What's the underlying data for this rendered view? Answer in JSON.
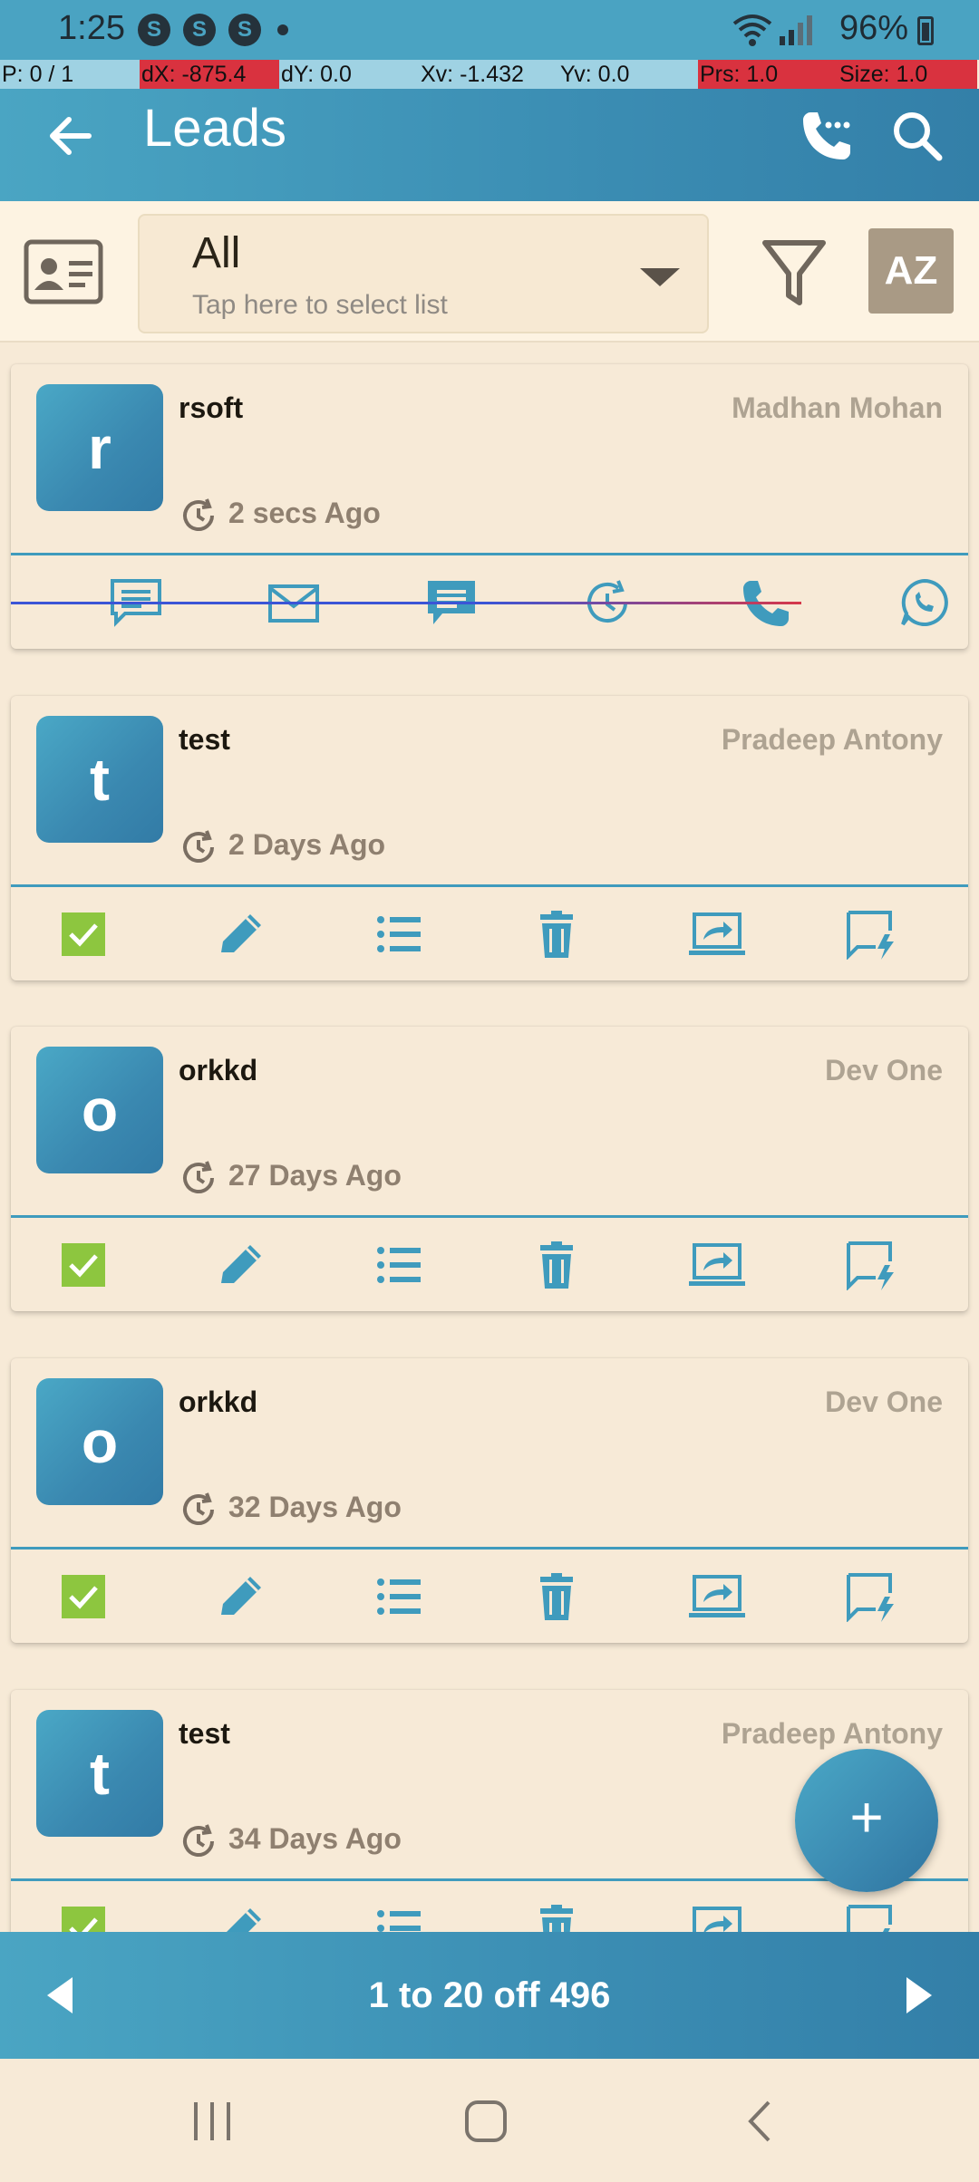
{
  "status_bar": {
    "time": "1:25",
    "notification_icons": [
      "S",
      "S",
      "S"
    ],
    "battery": "96%"
  },
  "debug_overlay": [
    {
      "text": "P: 0 / 1",
      "color": "#9fd2e3"
    },
    {
      "text": "dX: -875.4",
      "color": "#d9323f"
    },
    {
      "text": "dY: 0.0",
      "color": "#9fd2e3"
    },
    {
      "text": "Xv: -1.432",
      "color": "#9fd2e3"
    },
    {
      "text": "Yv: 0.0",
      "color": "#9fd2e3"
    },
    {
      "text": "Prs: 1.0",
      "color": "#d9323f"
    },
    {
      "text": "Size: 1.0",
      "color": "#d9323f"
    }
  ],
  "app_bar": {
    "title": "Leads"
  },
  "filter": {
    "list_value": "All",
    "list_hint": "Tap here to select list",
    "sort_label": "AZ"
  },
  "leads": [
    {
      "initial": "r",
      "name": "rsoft",
      "owner": "Madhan Mohan",
      "ago": "2 secs Ago",
      "swiped": true
    },
    {
      "initial": "t",
      "name": "test",
      "owner": "Pradeep Antony",
      "ago": "2 Days Ago",
      "swiped": false
    },
    {
      "initial": "o",
      "name": "orkkd",
      "owner": "Dev One",
      "ago": "27 Days Ago",
      "swiped": false
    },
    {
      "initial": "o",
      "name": "orkkd",
      "owner": "Dev One",
      "ago": "32 Days Ago",
      "swiped": false
    },
    {
      "initial": "t",
      "name": "test",
      "owner": "Pradeep Antony",
      "ago": "34 Days Ago",
      "swiped": false
    }
  ],
  "pager": {
    "label": "1 to 20 off 496"
  },
  "colors": {
    "accent": "#3f9bbd",
    "background": "#f7ead7",
    "check_green": "#8dc63f"
  },
  "icons": {
    "swipe_actions": [
      "sms-icon",
      "email-icon",
      "chat-icon",
      "followup-icon",
      "call-icon",
      "whatsapp-icon"
    ],
    "row_actions": [
      "checkbox-icon",
      "edit-icon",
      "list-icon",
      "delete-icon",
      "share-screen-icon",
      "quick-message-icon"
    ]
  },
  "fab": {
    "label": "+"
  }
}
